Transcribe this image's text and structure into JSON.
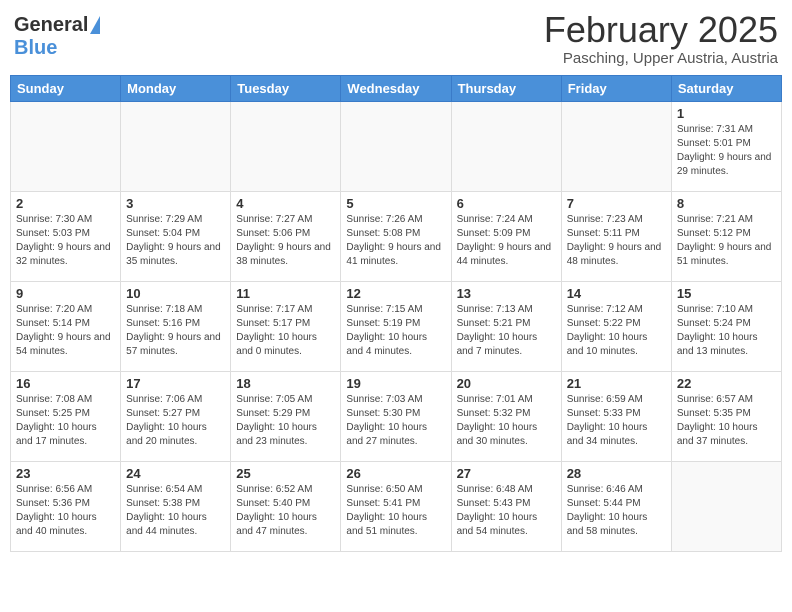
{
  "header": {
    "logo_general": "General",
    "logo_blue": "Blue",
    "month_title": "February 2025",
    "location": "Pasching, Upper Austria, Austria"
  },
  "weekdays": [
    "Sunday",
    "Monday",
    "Tuesday",
    "Wednesday",
    "Thursday",
    "Friday",
    "Saturday"
  ],
  "weeks": [
    [
      {
        "day": "",
        "info": ""
      },
      {
        "day": "",
        "info": ""
      },
      {
        "day": "",
        "info": ""
      },
      {
        "day": "",
        "info": ""
      },
      {
        "day": "",
        "info": ""
      },
      {
        "day": "",
        "info": ""
      },
      {
        "day": "1",
        "info": "Sunrise: 7:31 AM\nSunset: 5:01 PM\nDaylight: 9 hours and 29 minutes."
      }
    ],
    [
      {
        "day": "2",
        "info": "Sunrise: 7:30 AM\nSunset: 5:03 PM\nDaylight: 9 hours and 32 minutes."
      },
      {
        "day": "3",
        "info": "Sunrise: 7:29 AM\nSunset: 5:04 PM\nDaylight: 9 hours and 35 minutes."
      },
      {
        "day": "4",
        "info": "Sunrise: 7:27 AM\nSunset: 5:06 PM\nDaylight: 9 hours and 38 minutes."
      },
      {
        "day": "5",
        "info": "Sunrise: 7:26 AM\nSunset: 5:08 PM\nDaylight: 9 hours and 41 minutes."
      },
      {
        "day": "6",
        "info": "Sunrise: 7:24 AM\nSunset: 5:09 PM\nDaylight: 9 hours and 44 minutes."
      },
      {
        "day": "7",
        "info": "Sunrise: 7:23 AM\nSunset: 5:11 PM\nDaylight: 9 hours and 48 minutes."
      },
      {
        "day": "8",
        "info": "Sunrise: 7:21 AM\nSunset: 5:12 PM\nDaylight: 9 hours and 51 minutes."
      }
    ],
    [
      {
        "day": "9",
        "info": "Sunrise: 7:20 AM\nSunset: 5:14 PM\nDaylight: 9 hours and 54 minutes."
      },
      {
        "day": "10",
        "info": "Sunrise: 7:18 AM\nSunset: 5:16 PM\nDaylight: 9 hours and 57 minutes."
      },
      {
        "day": "11",
        "info": "Sunrise: 7:17 AM\nSunset: 5:17 PM\nDaylight: 10 hours and 0 minutes."
      },
      {
        "day": "12",
        "info": "Sunrise: 7:15 AM\nSunset: 5:19 PM\nDaylight: 10 hours and 4 minutes."
      },
      {
        "day": "13",
        "info": "Sunrise: 7:13 AM\nSunset: 5:21 PM\nDaylight: 10 hours and 7 minutes."
      },
      {
        "day": "14",
        "info": "Sunrise: 7:12 AM\nSunset: 5:22 PM\nDaylight: 10 hours and 10 minutes."
      },
      {
        "day": "15",
        "info": "Sunrise: 7:10 AM\nSunset: 5:24 PM\nDaylight: 10 hours and 13 minutes."
      }
    ],
    [
      {
        "day": "16",
        "info": "Sunrise: 7:08 AM\nSunset: 5:25 PM\nDaylight: 10 hours and 17 minutes."
      },
      {
        "day": "17",
        "info": "Sunrise: 7:06 AM\nSunset: 5:27 PM\nDaylight: 10 hours and 20 minutes."
      },
      {
        "day": "18",
        "info": "Sunrise: 7:05 AM\nSunset: 5:29 PM\nDaylight: 10 hours and 23 minutes."
      },
      {
        "day": "19",
        "info": "Sunrise: 7:03 AM\nSunset: 5:30 PM\nDaylight: 10 hours and 27 minutes."
      },
      {
        "day": "20",
        "info": "Sunrise: 7:01 AM\nSunset: 5:32 PM\nDaylight: 10 hours and 30 minutes."
      },
      {
        "day": "21",
        "info": "Sunrise: 6:59 AM\nSunset: 5:33 PM\nDaylight: 10 hours and 34 minutes."
      },
      {
        "day": "22",
        "info": "Sunrise: 6:57 AM\nSunset: 5:35 PM\nDaylight: 10 hours and 37 minutes."
      }
    ],
    [
      {
        "day": "23",
        "info": "Sunrise: 6:56 AM\nSunset: 5:36 PM\nDaylight: 10 hours and 40 minutes."
      },
      {
        "day": "24",
        "info": "Sunrise: 6:54 AM\nSunset: 5:38 PM\nDaylight: 10 hours and 44 minutes."
      },
      {
        "day": "25",
        "info": "Sunrise: 6:52 AM\nSunset: 5:40 PM\nDaylight: 10 hours and 47 minutes."
      },
      {
        "day": "26",
        "info": "Sunrise: 6:50 AM\nSunset: 5:41 PM\nDaylight: 10 hours and 51 minutes."
      },
      {
        "day": "27",
        "info": "Sunrise: 6:48 AM\nSunset: 5:43 PM\nDaylight: 10 hours and 54 minutes."
      },
      {
        "day": "28",
        "info": "Sunrise: 6:46 AM\nSunset: 5:44 PM\nDaylight: 10 hours and 58 minutes."
      },
      {
        "day": "",
        "info": ""
      }
    ]
  ]
}
